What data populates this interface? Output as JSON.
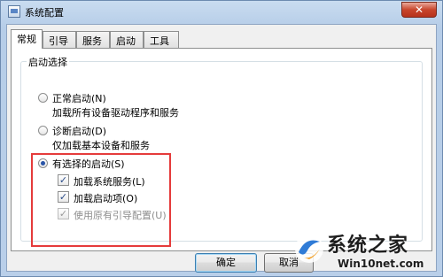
{
  "window": {
    "title": "系统配置",
    "close_label": "✕"
  },
  "tabs": [
    {
      "label": "常规",
      "active": true
    },
    {
      "label": "引导",
      "active": false
    },
    {
      "label": "服务",
      "active": false
    },
    {
      "label": "启动",
      "active": false
    },
    {
      "label": "工具",
      "active": false
    }
  ],
  "startup": {
    "group_title": "启动选择",
    "normal": {
      "label": "正常启动(N)",
      "desc": "加载所有设备驱动程序和服务",
      "selected": false
    },
    "diagnostic": {
      "label": "诊断启动(D)",
      "desc": "仅加载基本设备和服务",
      "selected": false
    },
    "selective": {
      "label": "有选择的启动(S)",
      "selected": true,
      "options": {
        "load_services": {
          "label": "加载系统服务(L)",
          "checked": true
        },
        "load_startup": {
          "label": "加载启动项(O)",
          "checked": true
        },
        "use_original_boot": {
          "label": "使用原有引导配置(U)",
          "checked": true,
          "disabled": true
        }
      }
    }
  },
  "buttons": {
    "ok": "确定",
    "cancel": "取消"
  },
  "watermark": {
    "title": "系统之家",
    "url": "Win10net.com"
  },
  "colors": {
    "highlight": "#e53b3b",
    "title_gradient": "#c9dcf0"
  }
}
